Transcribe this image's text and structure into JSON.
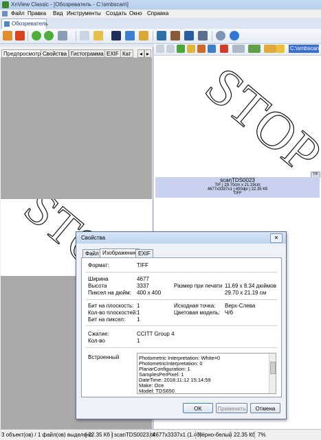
{
  "window": {
    "title": "XnView Classic - [Обозреватель - C:\\smbscan\\]"
  },
  "menu": [
    "Файл",
    "Правка",
    "Вид",
    "Инструменты",
    "Создать",
    "Окно",
    "Справка"
  ],
  "main_tab": "Обозреватель",
  "left_tabs": [
    "Предпросмотр",
    "Свойства",
    "Гистограмма",
    "EXIF",
    "Кат"
  ],
  "path": "C:\\smbscan\\",
  "preview_text": "STOP",
  "thumbnail": {
    "name": "scanTDS0023",
    "line1": "TIF | 29.70cm x 21.19cm",
    "line2": "4677x3337x1 | 400dpi | 22.35 Кб",
    "line3": "TIFF",
    "badge": "TIF"
  },
  "dialog": {
    "title": "Свойства",
    "tabs": [
      "Файл",
      "Изображение",
      "EXIF"
    ],
    "format_label": "Формат:",
    "format_value": "TIFF",
    "width_label": "Ширина",
    "width_value": "4677",
    "height_label": "Высота",
    "height_value": "3337",
    "ppi_label": "Пиксел на дюйм:",
    "ppi_value": "400 x 400",
    "printsize_label": "Размер при печати",
    "printsize_in": "11.69 x 8.34 дюймов",
    "printsize_cm": "29.70 x 21.19 см",
    "bpp_plane_label": "Бит на плоскость:",
    "bpp_plane_value": "1",
    "planes_label": "Кол-во плоскостей:",
    "planes_value": "1",
    "bpp_label": "Бит на пиксел:",
    "bpp_value": "1",
    "origin_label": "Исходная точка:",
    "origin_value": "Верх-Слева",
    "color_label": "Цветовая модель:",
    "color_value": "Ч/б",
    "compression_label": "Сжатие:",
    "compression_value": "CCITT Group 4",
    "count_label": "Кол-во",
    "count_value": "1",
    "embedded_label": "Встроенный",
    "embedded_lines": [
      "Photometric Interpretation: White=0",
      "PhotometricInterpretation: 0",
      "PlanarConfiguration: 1",
      "SamplesPerPixel: 1",
      "DateTime: 2018:11:12 15:14:59",
      "Make: Oce",
      "Model: TDS650"
    ],
    "ok": "OK",
    "apply": "Применить",
    "cancel": "Отмена"
  },
  "status": {
    "objects": "3 объект(ов) / 1 файл(ов) выделено",
    "size": "[ 22.35 Кб ]",
    "file": "scanTDS0023.tif",
    "dims": "4677x3337x1 (1.40)",
    "color": "Чёрно-белый",
    "size2": "22.35 Кб",
    "zoom": "7%"
  }
}
